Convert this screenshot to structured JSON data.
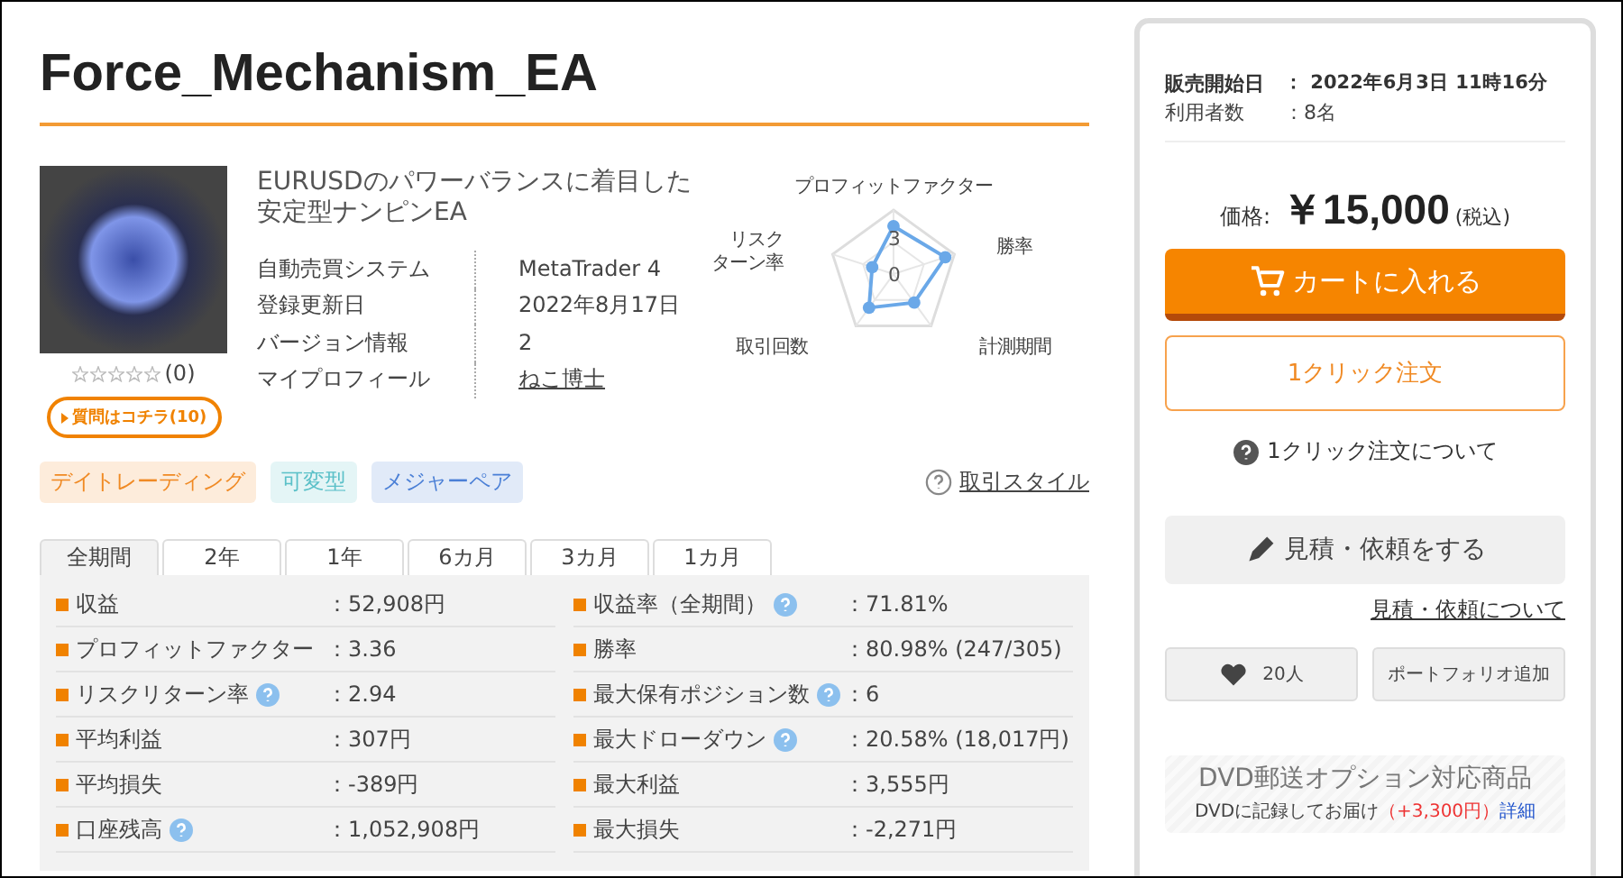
{
  "title": "Force_Mechanism_EA",
  "product": {
    "stars": 0,
    "rating_count": "(0)",
    "question_button": "質問はコチラ(10)",
    "description": "EURUSDのパワーバランスに着目した安定型ナンピンEA",
    "info": [
      {
        "label": "自動売買システム",
        "value": "MetaTrader 4",
        "kind": "text"
      },
      {
        "label": "登録更新日",
        "value": "2022年8月17日",
        "kind": "text"
      },
      {
        "label": "バージョン情報",
        "value": "2",
        "kind": "text"
      },
      {
        "label": "マイプロフィール",
        "value": "ねこ博士",
        "kind": "link"
      }
    ]
  },
  "radar": {
    "axis_labels": [
      {
        "lines": [
          "プロフィットファクター"
        ]
      },
      {
        "lines": [
          "勝率"
        ]
      },
      {
        "lines": [
          "計測期間"
        ]
      },
      {
        "lines": [
          "取引回数"
        ]
      },
      {
        "lines": [
          "リスク",
          "ターン率"
        ]
      }
    ],
    "scale_labels": [
      "3",
      "0"
    ]
  },
  "tags": [
    {
      "label": "デイトレーディング",
      "color": "#f08a24"
    },
    {
      "label": "可変型",
      "color": "#5bc0c8"
    },
    {
      "label": "メジャーペア",
      "color": "#4a7fd6"
    }
  ],
  "trade_style_link": "取引スタイル",
  "period_tabs": [
    {
      "label": "全期間",
      "selected": true
    },
    {
      "label": "2年",
      "selected": false
    },
    {
      "label": "1年",
      "selected": false
    },
    {
      "label": "6カ月",
      "selected": false
    },
    {
      "label": "3カ月",
      "selected": false
    },
    {
      "label": "1カ月",
      "selected": false
    }
  ],
  "stats": [
    [
      {
        "label": "収益",
        "value": "：52,908円",
        "help": false
      },
      {
        "label": "収益率（全期間）",
        "value": "：71.81%",
        "help": true
      }
    ],
    [
      {
        "label": "プロフィットファクター",
        "value": "：3.36",
        "help": false
      },
      {
        "label": "勝率",
        "value": "：80.98% (247/305)",
        "help": false
      }
    ],
    [
      {
        "label": "リスクリターン率",
        "value": "：2.94",
        "help": true
      },
      {
        "label": "最大保有ポジション数",
        "value": "：6",
        "help": true
      }
    ],
    [
      {
        "label": "平均利益",
        "value": "：307円",
        "help": false
      },
      {
        "label": "最大ドローダウン",
        "value": "：20.58% (18,017円)",
        "help": true
      }
    ],
    [
      {
        "label": "平均損失",
        "value": "：-389円",
        "help": false
      },
      {
        "label": "最大利益",
        "value": "：3,555円",
        "help": false
      }
    ],
    [
      {
        "label": "口座残高",
        "value": "：1,052,908円",
        "help": true
      },
      {
        "label": "最大損失",
        "value": "：-2,271円",
        "help": false
      }
    ]
  ],
  "sidebar": {
    "meta": [
      {
        "label": "販売開始日",
        "value": "：  2022年6月3日 11時16分",
        "bold": true
      },
      {
        "label": "利用者数",
        "value": "：8名",
        "bold": false
      }
    ],
    "price_label": "価格:",
    "price": "￥15,000",
    "tax": "(税込)",
    "cart_button": "カートに入れる",
    "one_click_button": "1クリック注文",
    "one_click_help": "1クリック注文について",
    "quote_button": "見積・依頼をする",
    "quote_link": "見積・依頼について",
    "favorite_count": "20人",
    "portfolio_button": "ポートフォリオ追加",
    "dvd": {
      "title": "DVD郵送オプション対応商品",
      "text": "DVDに記録してお届け",
      "price": "（+3,300円）",
      "link": "詳細"
    }
  }
}
